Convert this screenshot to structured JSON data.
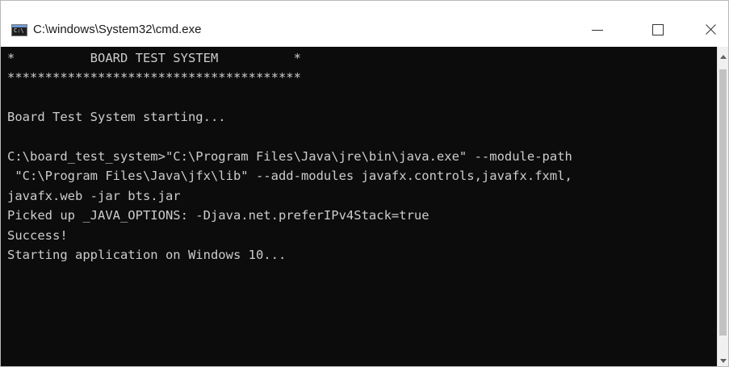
{
  "window": {
    "title": "C:\\windows\\System32\\cmd.exe",
    "icon": "cmd-icon",
    "icon_label": "C:\\",
    "controls": [
      "minimize-icon",
      "maximize-icon",
      "close-icon"
    ]
  },
  "console": {
    "background": "#0c0c0c",
    "foreground": "#cccccc",
    "lines": [
      "*          BOARD TEST SYSTEM          *",
      "***************************************",
      "",
      "Board Test System starting...",
      "",
      "C:\\board_test_system>\"C:\\Program Files\\Java\\jre\\bin\\java.exe\" --module-path",
      " \"C:\\Program Files\\Java\\jfx\\lib\" --add-modules javafx.controls,javafx.fxml,",
      "javafx.web -jar bts.jar",
      "Picked up _JAVA_OPTIONS: -Djava.net.preferIPv4Stack=true",
      "Success!",
      "Starting application on Windows 10..."
    ]
  }
}
